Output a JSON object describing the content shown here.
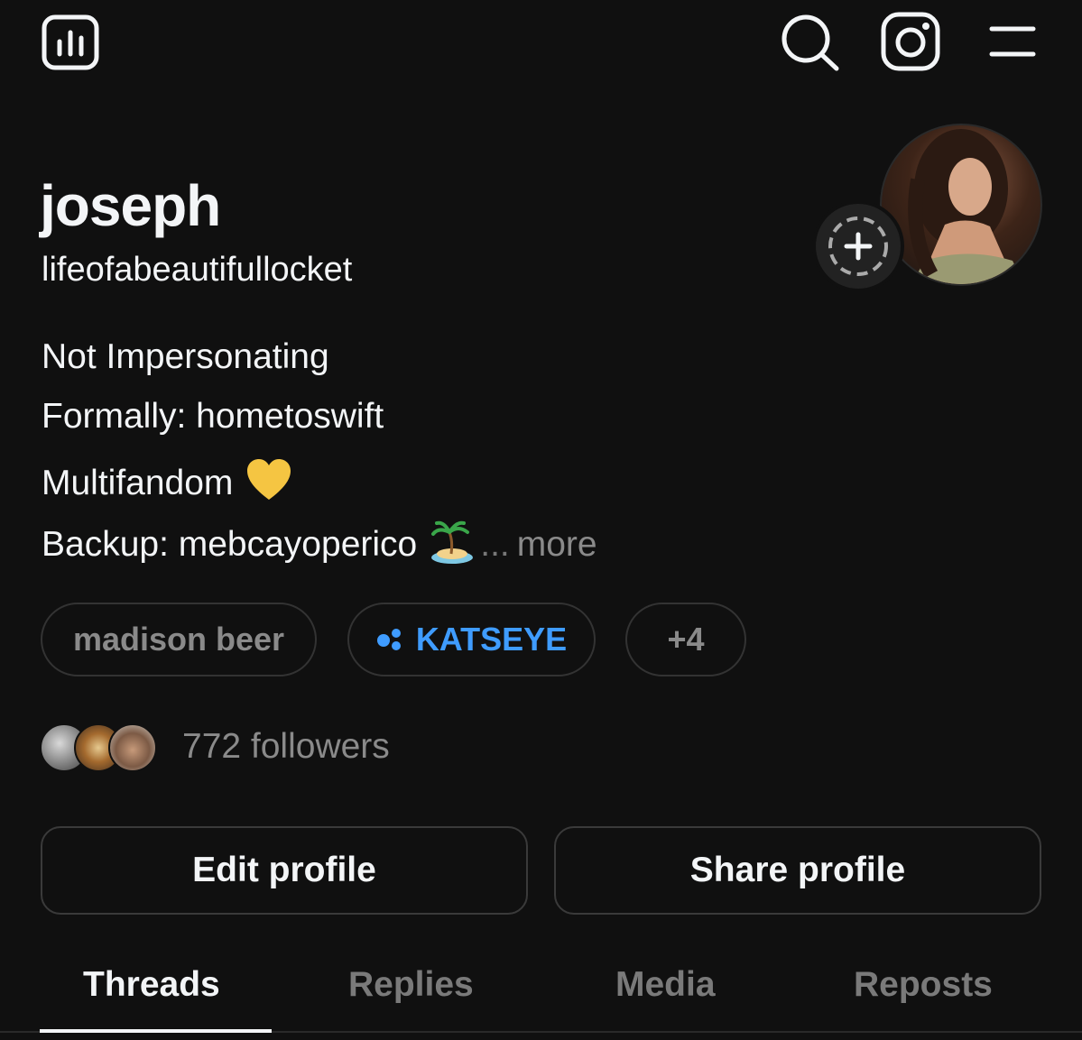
{
  "topbar": {
    "icons": [
      "bar-chart-icon",
      "search-icon",
      "instagram-icon",
      "menu-icon"
    ]
  },
  "profile": {
    "display_name": "joseph",
    "username": "lifeofabeautifullocket",
    "bio": {
      "line1": "Not Impersonating",
      "line2": "Formally: hometoswift",
      "line3": "Multifandom",
      "line3_emoji": "yellow-heart",
      "line4": "Backup: mebcayoperico",
      "line4_emoji": "desert-island",
      "ellipsis": "...",
      "more": "more"
    },
    "tags": [
      {
        "label": "madison beer"
      },
      {
        "label": "KATSEYE",
        "color": "#3f9cff",
        "icon": "community-dots-icon"
      },
      {
        "label": "+4"
      }
    ],
    "followers": "772 followers"
  },
  "actions": {
    "edit": "Edit profile",
    "share": "Share profile"
  },
  "tabs": {
    "threads": "Threads",
    "replies": "Replies",
    "media": "Media",
    "reposts": "Reposts",
    "active": "Threads"
  },
  "colors": {
    "background": "#101010",
    "text": "#f3f5f7",
    "muted": "#8a8a8a",
    "accent": "#3f9cff",
    "border": "#333333"
  }
}
